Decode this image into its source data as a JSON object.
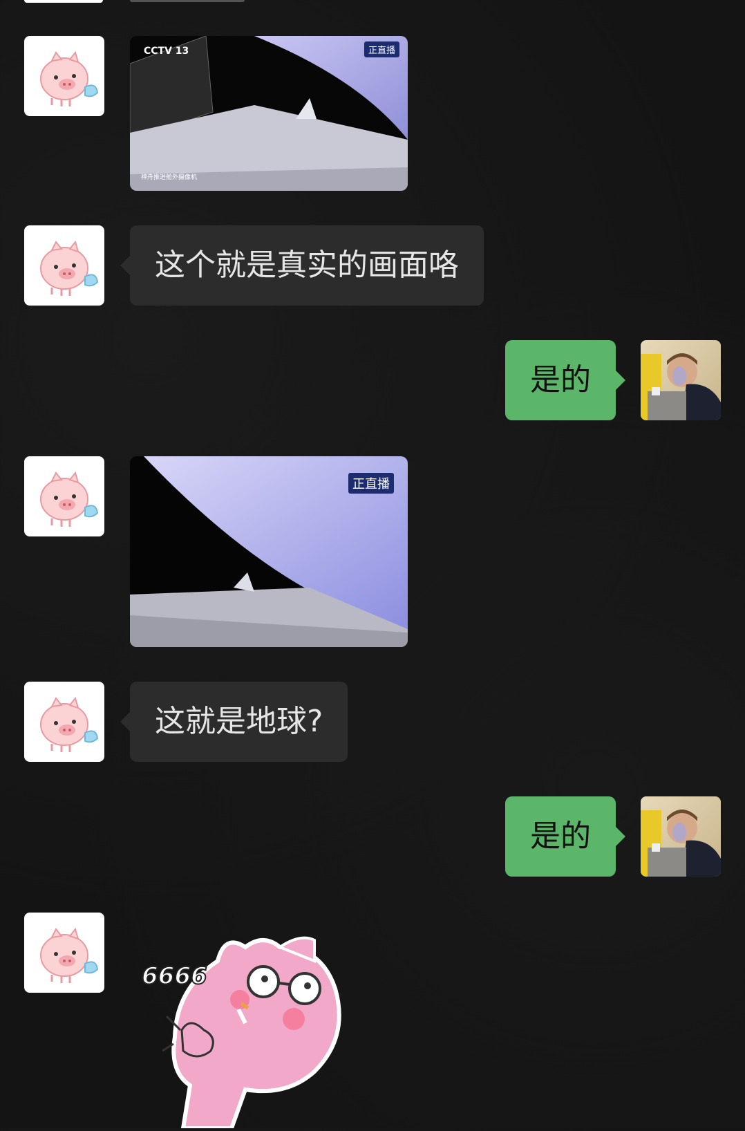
{
  "messages": [
    {
      "type": "image",
      "side": "left",
      "sender_avatar": "pig-avatar",
      "badge_text": "正直播",
      "channel": "CCTV 13",
      "caption": "神舟推进舱外摄像机"
    },
    {
      "type": "text",
      "side": "left",
      "sender_avatar": "pig-avatar",
      "text": "这个就是真实的画面咯"
    },
    {
      "type": "text",
      "side": "right",
      "sender_avatar": "photo-avatar",
      "text": "是的"
    },
    {
      "type": "image",
      "side": "left",
      "sender_avatar": "pig-avatar",
      "badge_text": "正直播"
    },
    {
      "type": "text",
      "side": "left",
      "sender_avatar": "pig-avatar",
      "text": "这就是地球?"
    },
    {
      "type": "text",
      "side": "right",
      "sender_avatar": "photo-avatar",
      "text": "是的"
    },
    {
      "type": "sticker",
      "side": "left",
      "sender_avatar": "pig-avatar",
      "text": "6666"
    }
  ],
  "colors": {
    "background": "#141414",
    "incoming_bubble": "#2c2c2c",
    "outgoing_bubble": "#5bb66a"
  }
}
